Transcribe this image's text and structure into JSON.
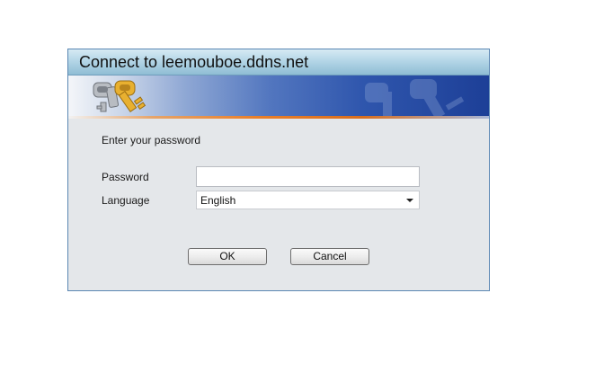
{
  "dialog": {
    "title": "Connect to leemouboe.ddns.net",
    "prompt": "Enter your password",
    "banner": {
      "icon": "keys-icon",
      "watermark_icon": "keys-watermark-icon"
    },
    "fields": {
      "password": {
        "label": "Password",
        "value": "",
        "placeholder": ""
      },
      "language": {
        "label": "Language",
        "selected": "English"
      }
    },
    "buttons": {
      "ok_label": "OK",
      "cancel_label": "Cancel"
    }
  },
  "colors": {
    "border": "#5b87b3",
    "dialog_bg": "#e4e7ea",
    "banner_blue": "#2f56ad",
    "banner_orange_stripe": "#e87f2a",
    "key_gold": "#e8b030",
    "key_silver": "#b8bcc2"
  }
}
